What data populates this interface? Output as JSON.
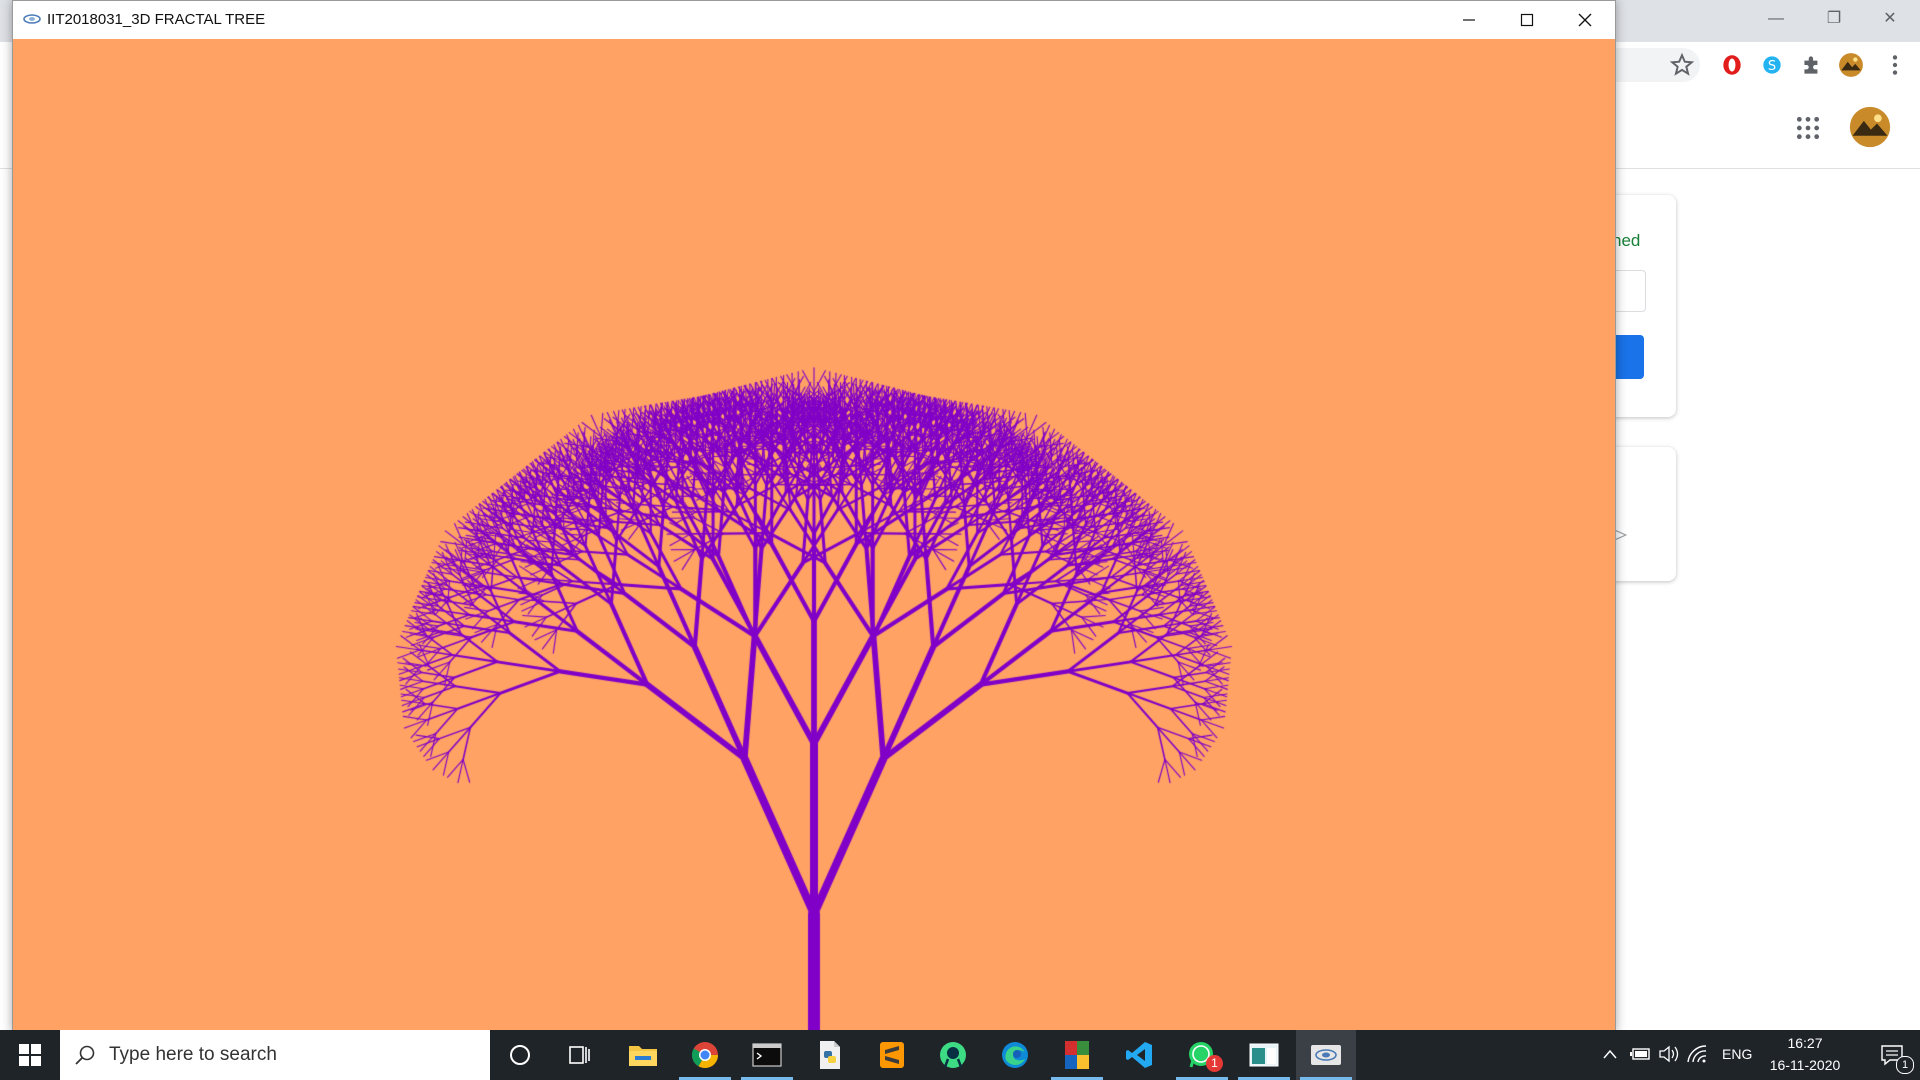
{
  "app_window": {
    "title": "IIT2018031_3D FRACTAL TREE",
    "background_color": "#ffa264",
    "tree_color": "#8000c8",
    "icon": "opengl-app-icon"
  },
  "background_browser": {
    "card_text_fragment": "ned",
    "accent_color": "#1a73e8",
    "status_text_color": "#188038"
  },
  "taskbar": {
    "search_placeholder": "Type here to search",
    "apps": [
      {
        "name": "cortana",
        "icon": "circle-icon"
      },
      {
        "name": "task-view",
        "icon": "task-view-icon"
      },
      {
        "name": "file-explorer",
        "icon": "folder-icon"
      },
      {
        "name": "chrome",
        "icon": "chrome-icon"
      },
      {
        "name": "terminal",
        "icon": "terminal-icon"
      },
      {
        "name": "python",
        "icon": "python-file-icon"
      },
      {
        "name": "sublime-text",
        "icon": "sublime-icon"
      },
      {
        "name": "android-studio",
        "icon": "android-studio-icon"
      },
      {
        "name": "edge",
        "icon": "edge-icon"
      },
      {
        "name": "winrar",
        "icon": "winrar-icon"
      },
      {
        "name": "vscode",
        "icon": "vscode-icon"
      },
      {
        "name": "whatsapp",
        "icon": "whatsapp-icon",
        "badge": "1"
      },
      {
        "name": "snip",
        "icon": "window-icon"
      },
      {
        "name": "opengl-app",
        "icon": "opengl-app-icon"
      }
    ],
    "tray": {
      "language": "ENG",
      "time": "16:27",
      "date": "16-11-2020",
      "notification_count": "1"
    }
  }
}
